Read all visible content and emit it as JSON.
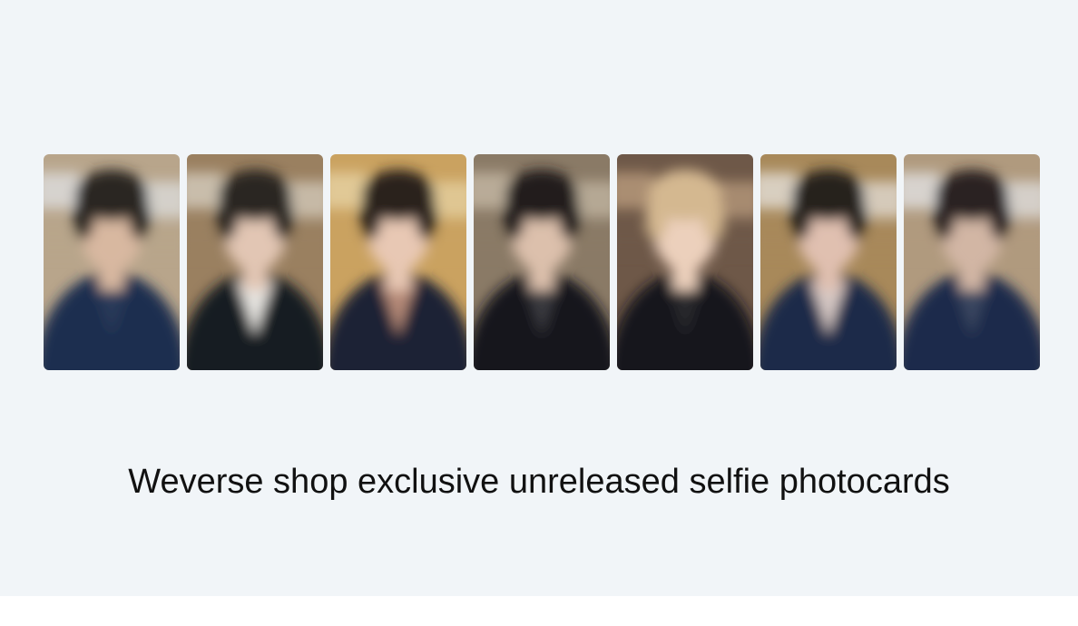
{
  "caption": "Weverse shop exclusive unreleased selfie photocards",
  "photocards": [
    {
      "icon": "blurred-portrait",
      "background": "#b8a58b",
      "hair": "#2a2520",
      "skin": "#d8b8a0",
      "top": "#1f2f4f",
      "inner": "#2a3a5a",
      "light": "#e0e2e4"
    },
    {
      "icon": "blurred-portrait",
      "background": "#9a8060",
      "hair": "#2c2620",
      "skin": "#e2c6b4",
      "top": "#181c24",
      "inner": "#e6e4e0",
      "light": "#d8d2c4"
    },
    {
      "icon": "blurred-portrait",
      "background": "#caa260",
      "hair": "#2a221c",
      "skin": "#e8c8b4",
      "top": "#1a2236",
      "inner": "#b68a78",
      "light": "#e8d6a8"
    },
    {
      "icon": "blurred-portrait",
      "background": "#8a7a66",
      "hair": "#221e1c",
      "skin": "#dcc0ac",
      "top": "#15171c",
      "inner": "#3a3a40",
      "light": "#c8bca8"
    },
    {
      "icon": "blurred-portrait",
      "background": "#6e5848",
      "hair": "#d4b890",
      "skin": "#ecd0bc",
      "top": "#16181e",
      "inner": "#2a2a2e",
      "light": "#bfa080"
    },
    {
      "icon": "blurred-portrait",
      "background": "#a8895a",
      "hair": "#26201c",
      "skin": "#e0c0b0",
      "top": "#1c2a4a",
      "inner": "#d6c8c4",
      "light": "#e8e6e2"
    },
    {
      "icon": "blurred-portrait",
      "background": "#b09a7e",
      "hair": "#2a2420",
      "skin": "#d2b6a4",
      "top": "#1e2c4c",
      "inner": "#3a4660",
      "light": "#e4e6e8"
    }
  ]
}
